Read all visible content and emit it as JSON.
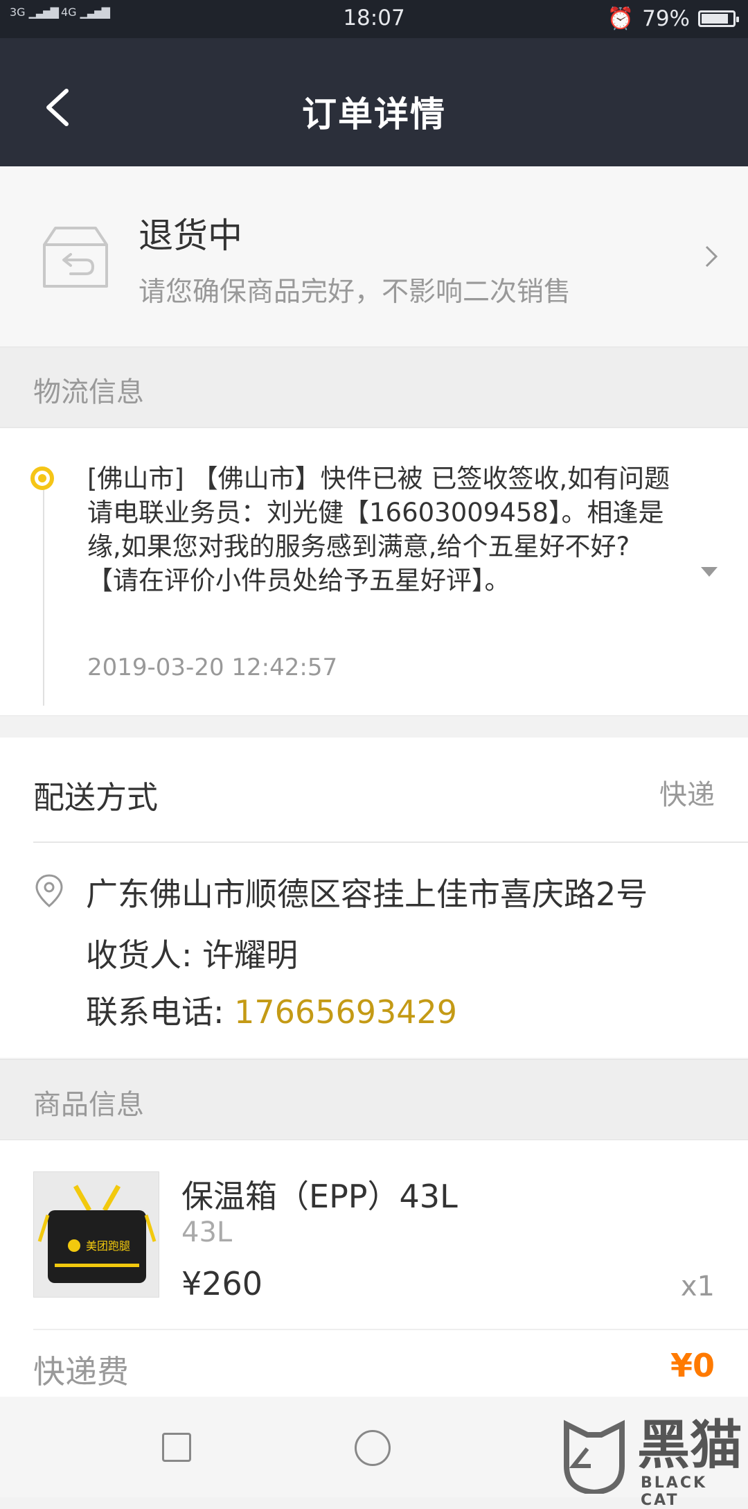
{
  "status_bar": {
    "signal_left": "3G",
    "signal_right": "4G",
    "time": "18:07",
    "battery": "79%"
  },
  "nav": {
    "title": "订单详情"
  },
  "order_status": {
    "title": "退货中",
    "subtitle": "请您确保商品完好，不影响二次销售"
  },
  "logistics": {
    "section_title": "物流信息",
    "message": "[佛山市] 【佛山市】快件已被 已签收签收,如有问题请电联业务员：刘光健【16603009458】。相逢是缘,如果您对我的服务感到满意,给个五星好不好?【请在评价小件员处给予五星好评】。",
    "time": "2019-03-20 12:42:57"
  },
  "delivery": {
    "label": "配送方式",
    "value": "快递",
    "address": "广东佛山市顺德区容挂上佳市喜庆路2号",
    "receiver": "收货人: 许耀明",
    "phone_label": "联系电话: ",
    "phone": "17665693429"
  },
  "product": {
    "section_title": "商品信息",
    "name": "保温箱（EPP）43L",
    "spec": "43L",
    "price": "¥260",
    "qty": "x1",
    "fee_label": "快递费",
    "fee_value": "¥0",
    "thumb_text": "美团跑腿"
  },
  "watermark": {
    "text": "黑猫",
    "sub": "BLACK CAT"
  },
  "colors": {
    "accent_yellow": "#f5c517",
    "phone": "#c49a15",
    "fee": "#ff7a00",
    "nav_bg": "#2b2f3a"
  }
}
